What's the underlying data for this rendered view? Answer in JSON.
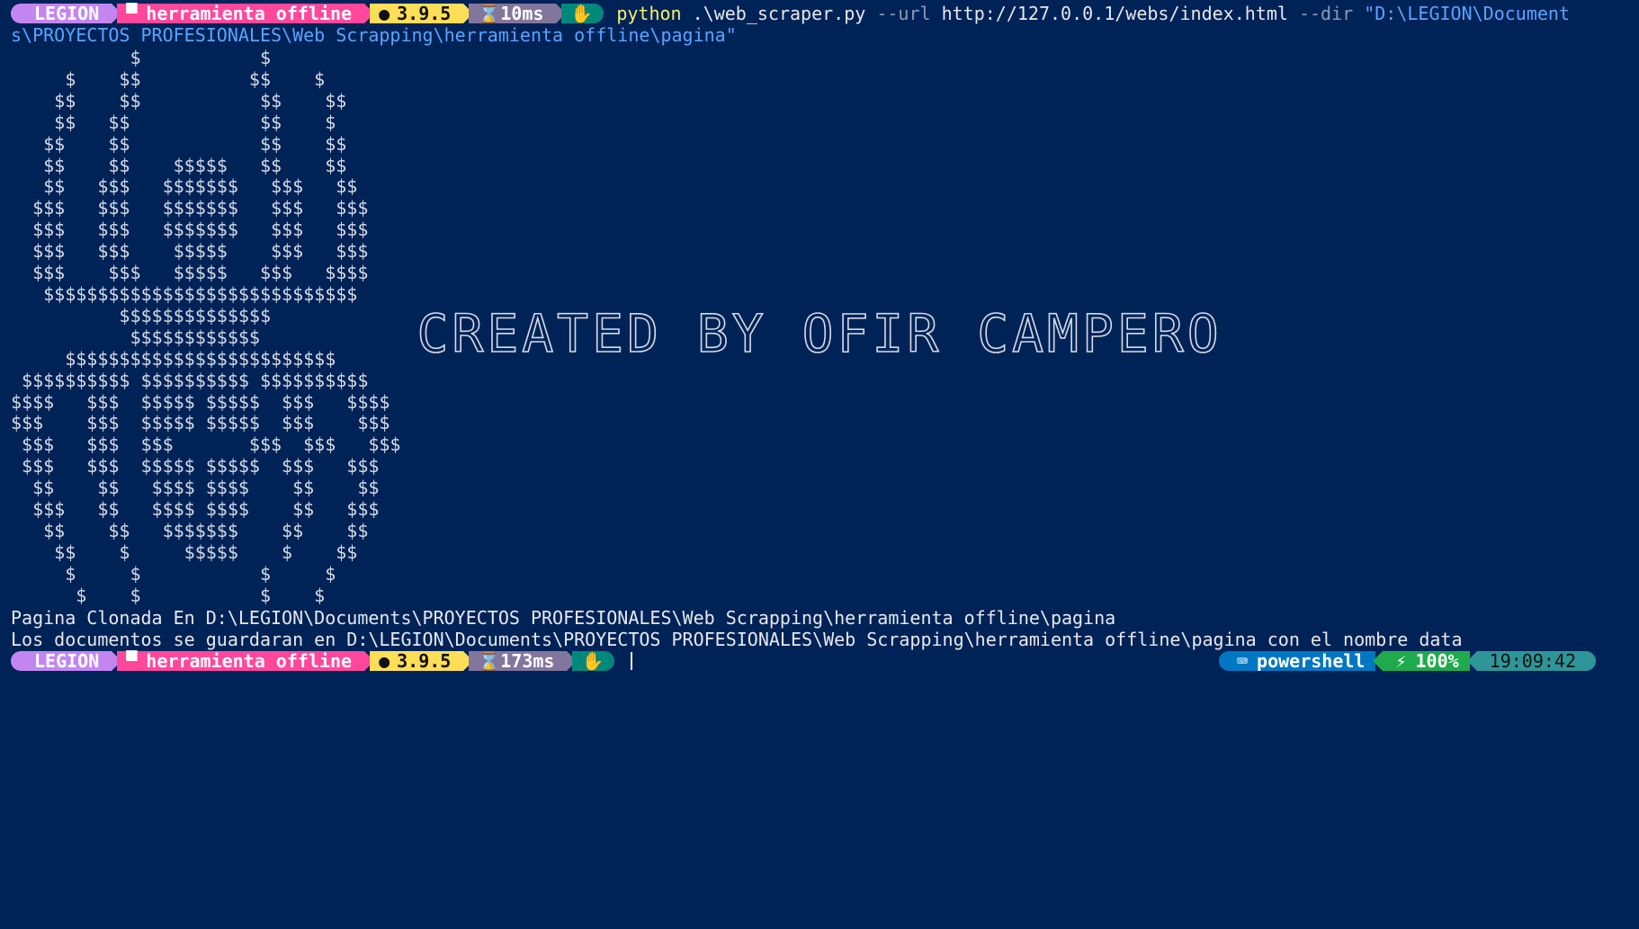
{
  "colors": {
    "background": "#002357",
    "user": "#c386f1",
    "path": "#ff479c",
    "python": "#ffde57",
    "time": "#83769c",
    "status": "#00897b",
    "shell": "#0077c2",
    "battery": "#1faa4b",
    "clock": "#2e9599"
  },
  "prompt1": {
    "user": "LEGION",
    "folder_icon": "folder-icon",
    "path": "herramienta offline",
    "python_icon": "python-icon",
    "python_version": "3.9.5",
    "hourglass_icon": "hourglass-icon",
    "exec_time": "10ms",
    "status_icon": "status-icon"
  },
  "command": {
    "exe": "python",
    "script": " .\\web_scraper.py ",
    "flag_url": "--url",
    "url": " http://127.0.0.1/webs/index.html ",
    "flag_dir": "--dir",
    "dir_part1": " \"D:\\LEGION\\Document",
    "dir_part2": "s\\PROYECTOS PROFESIONALES\\Web Scrapping\\herramienta offline\\pagina\""
  },
  "ascii_art": "           $           $\n     $    $$          $$    $\n    $$    $$           $$    $$\n    $$   $$            $$    $\n   $$    $$            $$    $$\n   $$    $$    $$$$$   $$    $$\n   $$   $$$   $$$$$$$   $$$   $$\n  $$$   $$$   $$$$$$$   $$$   $$$\n  $$$   $$$   $$$$$$$   $$$   $$$\n  $$$   $$$    $$$$$    $$$   $$$\n  $$$    $$$   $$$$$   $$$   $$$$\n   $$$$$$$$$$$$$$$$$$$$$$$$$$$$$\n          $$$$$$$$$$$$$$\n           $$$$$$$$$$$$\n     $$$$$$$$$$$$$$$$$$$$$$$$$\n $$$$$$$$$$ $$$$$$$$$$ $$$$$$$$$$\n$$$$   $$$  $$$$$ $$$$$  $$$   $$$$\n$$$    $$$  $$$$$ $$$$$  $$$    $$$\n $$$   $$$  $$$       $$$  $$$   $$$\n $$$   $$$  $$$$$ $$$$$  $$$   $$$\n  $$    $$   $$$$ $$$$    $$    $$\n  $$$   $$   $$$$ $$$$    $$   $$$\n   $$    $$   $$$$$$$    $$    $$\n    $$    $     $$$$$    $    $$\n     $     $           $     $\n      $    $           $    $",
  "banner": "CREATED BY OFIR CAMPERO",
  "output": {
    "line1": "Pagina Clonada En D:\\LEGION\\Documents\\PROYECTOS PROFESIONALES\\Web Scrapping\\herramienta offline\\pagina",
    "line2": "Los documentos se guardaran en D:\\LEGION\\Documents\\PROYECTOS PROFESIONALES\\Web Scrapping\\herramienta offline\\pagina con el nombre data"
  },
  "prompt2": {
    "user": "LEGION",
    "path": "herramienta offline",
    "python_version": "3.9.5",
    "exec_time": "173ms"
  },
  "right_prompt": {
    "shell_icon": "terminal-icon",
    "shell": "powershell",
    "battery_icon": "battery-plug-icon",
    "battery": "100%",
    "clock": "19:09:42"
  }
}
